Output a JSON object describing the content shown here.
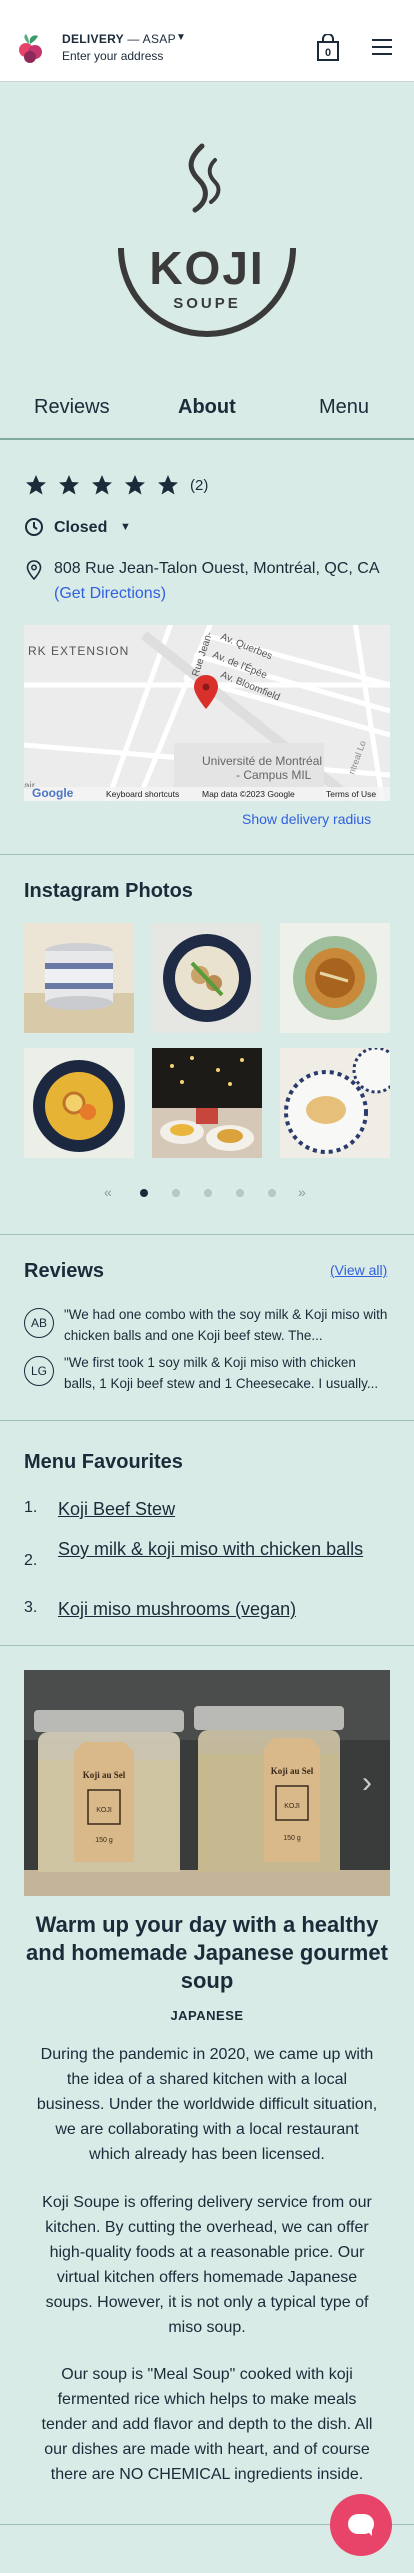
{
  "header": {
    "delivery_mode": "DELIVERY",
    "delivery_time": "— ASAP",
    "address_placeholder": "Enter your address",
    "cart_count": "0",
    "brand_color": "#e8446a"
  },
  "brand": {
    "name": "KOJI",
    "tagline": "SOUPE"
  },
  "tabs": [
    {
      "label": "Reviews",
      "active": false
    },
    {
      "label": "About",
      "active": true
    },
    {
      "label": "Menu",
      "active": false
    }
  ],
  "about": {
    "rating_stars": 5,
    "rating_count": "(2)",
    "hours_status": "Closed",
    "address": "808 Rue Jean-Talon Ouest, Montréal, QC, CA",
    "directions_label": "(Get Directions)",
    "show_radius_label": "Show delivery radius"
  },
  "map": {
    "label_extension": "RK EXTENSION",
    "street_jean": "Rue Jean-",
    "street_querbes": "Av. Querbes",
    "street_epee": "Av. de l'Épée",
    "street_bloomfield": "Av. Bloomfield",
    "university": "Université de Montréal",
    "campus": "- Campus MIL",
    "side_label": "ntreal Lo",
    "left_label": "air",
    "google": "Google",
    "shortcuts": "Keyboard shortcuts",
    "map_data": "Map data ©2023 Google",
    "terms": "Terms of Use"
  },
  "instagram": {
    "title": "Instagram Photos",
    "prev": "«",
    "next": "»",
    "pages": 6,
    "active_page": 1
  },
  "reviews": {
    "title": "Reviews",
    "view_all": "(View all)",
    "items": [
      {
        "initials": "AB",
        "text": "\"We had one combo with the soy milk & Koji miso with chicken balls and one Koji beef stew. The..."
      },
      {
        "initials": "LG",
        "text": "\"We first took 1 soy milk & Koji miso with chicken balls, 1 Koji beef stew and 1 Cheesecake. I usually..."
      }
    ]
  },
  "favourites": {
    "title": "Menu Favourites",
    "items": [
      {
        "num": "1.",
        "label": "Koji Beef Stew"
      },
      {
        "num": "2.",
        "label": "Soy milk & koji miso with chicken balls"
      },
      {
        "num": "3.",
        "label": "Koji miso mushrooms (vegan)"
      }
    ]
  },
  "promo": {
    "jar_label": "Koji au Sel",
    "jar_brand": "KOJI",
    "jar_weight": "150 g",
    "next_arrow": "›"
  },
  "story": {
    "title": "Warm up your day with a healthy and homemade Japanese gourmet soup",
    "tag": "JAPANESE",
    "paragraphs": [
      "During the pandemic in 2020, we came up with the idea of a shared kitchen with a local business. Under the worldwide difficult situation, we are collaborating with a local restaurant which already has been licensed.",
      "Koji Soupe is offering delivery service from our kitchen. By cutting the overhead, we can offer high-quality foods at a reasonable price. Our virtual kitchen offers homemade Japanese soups. However, it is not only a typical type of miso soup.",
      "Our soup is \"Meal Soup\" cooked with koji fermented rice which helps to make meals tender and add flavor and depth to the dish. All our dishes are made with heart, and of course there are NO CHEMICAL ingredients inside."
    ]
  }
}
